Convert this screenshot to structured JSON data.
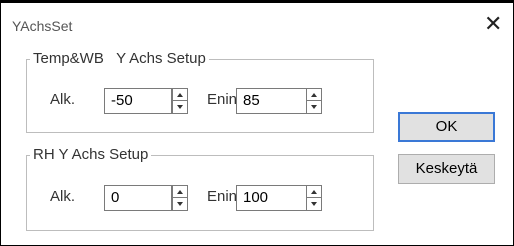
{
  "window": {
    "title": "YAchsSet",
    "close_glyph": "✕"
  },
  "group_temp": {
    "label": "Temp&WB   Y Achs Setup",
    "min_label": "Alk.",
    "min_value": "-50",
    "max_label": "Enint",
    "max_value": "85"
  },
  "group_rh": {
    "label": "RH Y Achs Setup",
    "min_label": "Alk.",
    "min_value": "0",
    "max_label": "Enint",
    "max_value": "100"
  },
  "buttons": {
    "ok": "OK",
    "cancel": "Keskeytä"
  },
  "icons": {
    "close": "close-icon",
    "spin_up": "chevron-up-icon",
    "spin_down": "chevron-down-icon"
  }
}
